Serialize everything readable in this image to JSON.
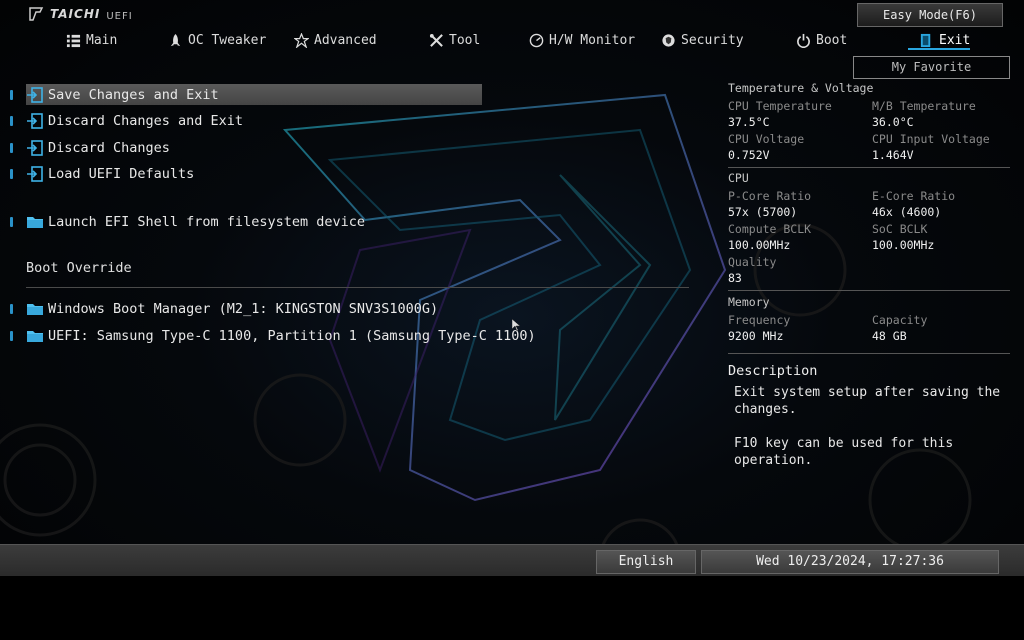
{
  "brand": {
    "name": "TAICHI",
    "sub": "UEFI"
  },
  "easy_mode": "Easy Mode(F6)",
  "nav": {
    "tabs": [
      {
        "label": "Main",
        "icon": "list-icon"
      },
      {
        "label": "OC Tweaker",
        "icon": "rocket-icon"
      },
      {
        "label": "Advanced",
        "icon": "star-icon"
      },
      {
        "label": "Tool",
        "icon": "tools-icon"
      },
      {
        "label": "H/W Monitor",
        "icon": "gauge-icon"
      },
      {
        "label": "Security",
        "icon": "shield-icon"
      },
      {
        "label": "Boot",
        "icon": "power-icon"
      },
      {
        "label": "Exit",
        "icon": "exit-icon"
      }
    ],
    "active": "Exit"
  },
  "my_favorite": "My Favorite",
  "menu": {
    "items": [
      {
        "label": "Save Changes and Exit",
        "icon": "exit-icon"
      },
      {
        "label": "Discard Changes and Exit",
        "icon": "exit-icon"
      },
      {
        "label": "Discard Changes",
        "icon": "exit-icon"
      },
      {
        "label": "Load UEFI Defaults",
        "icon": "exit-icon"
      },
      {
        "label": "Launch EFI Shell from filesystem device",
        "icon": "folder-icon"
      }
    ],
    "boot_override_title": "Boot Override",
    "boot_items": [
      {
        "label": "Windows Boot Manager (M2_1: KINGSTON SNV3S1000G)",
        "icon": "folder-icon"
      },
      {
        "label": "UEFI: Samsung Type-C 1100, Partition 1 (Samsung Type-C 1100)",
        "icon": "folder-icon"
      }
    ]
  },
  "monitor": {
    "temp_title": "Temperature & Voltage",
    "cpu_temp_label": "CPU Temperature",
    "cpu_temp": "37.5°C",
    "mb_temp_label": "M/B Temperature",
    "mb_temp": "36.0°C",
    "cpu_volt_label": "CPU Voltage",
    "cpu_volt": "0.752V",
    "cpu_in_volt_label": "CPU Input Voltage",
    "cpu_in_volt": "1.464V",
    "cpu_title": "CPU",
    "pcore_label": "P-Core Ratio",
    "pcore": "57x (5700)",
    "ecore_label": "E-Core Ratio",
    "ecore": "46x (4600)",
    "bclk_label": "Compute BCLK",
    "bclk": "100.00MHz",
    "soc_bclk_label": "SoC BCLK",
    "soc_bclk": "100.00MHz",
    "quality_label": "Quality",
    "quality": "83",
    "mem_title": "Memory",
    "freq_label": "Frequency",
    "freq": "9200 MHz",
    "cap_label": "Capacity",
    "cap": "48 GB"
  },
  "description": {
    "title": "Description",
    "line1": "Exit system setup after saving the changes.",
    "line2": "F10 key can be used for this operation."
  },
  "bottom": {
    "language": "English",
    "datetime": "Wed 10/23/2024, 17:27:36"
  },
  "colors": {
    "accent": "#2aa7e0",
    "selection": "#4f4f4f",
    "marker": "#2a92c9"
  }
}
